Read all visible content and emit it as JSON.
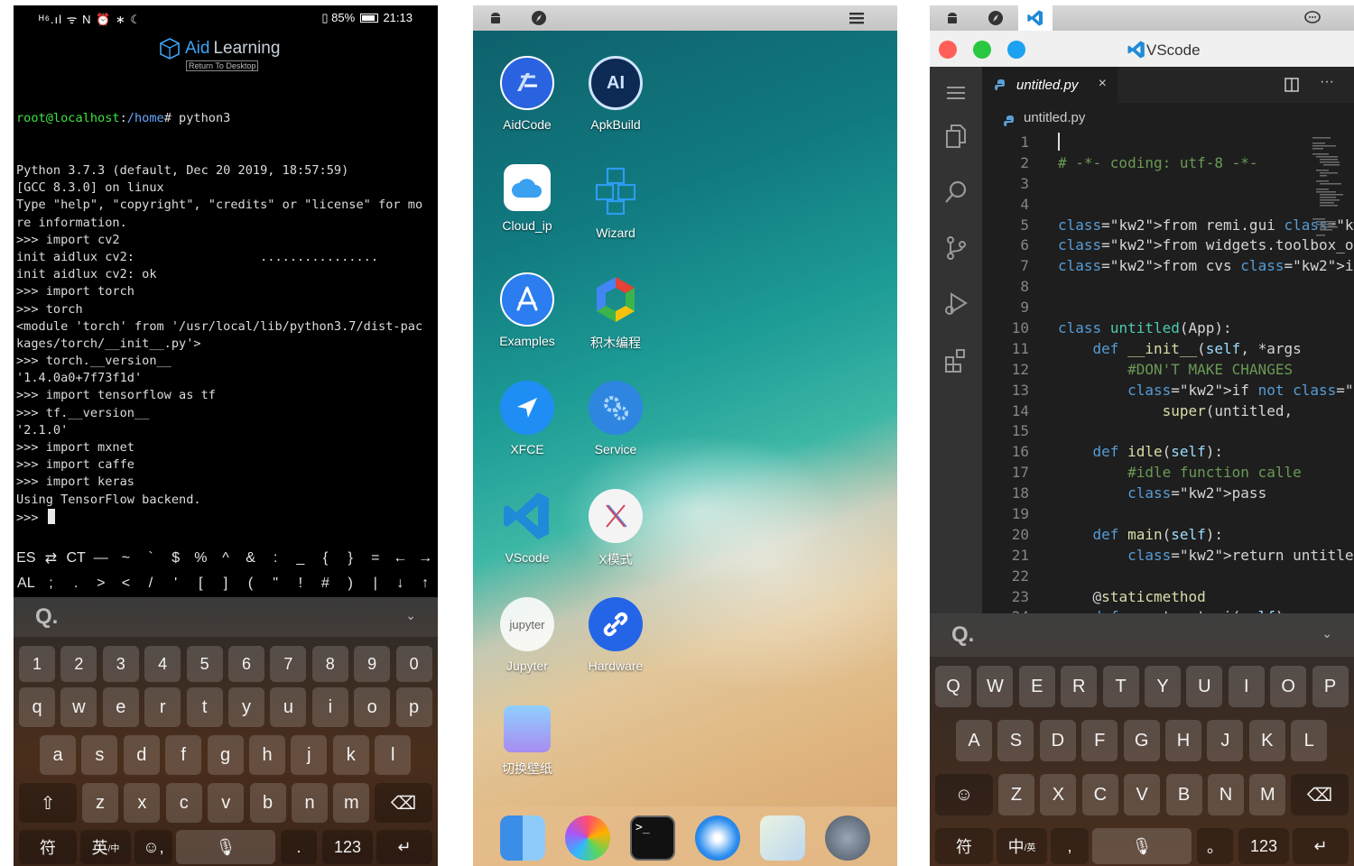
{
  "terminal_panel": {
    "status_left": "ᴴ⁶.ıl ᯤ N ⏰ ∗ ☾",
    "battery_label": "85%",
    "time": "21:13",
    "logo_text_1": "Aid",
    "logo_text_2": "Learning",
    "return_label": "Return To Desktop",
    "prompt_user": "root@localhost",
    "prompt_sep": ":",
    "prompt_path": "/home",
    "prompt_cmd": "# python3",
    "lines": [
      "Python 3.7.3 (default, Dec 20 2019, 18:57:59)",
      "[GCC 8.3.0] on linux",
      "Type \"help\", \"copyright\", \"credits\" or \"license\" for mo",
      "re information.",
      ">>> import cv2",
      "init aidlux cv2:                 ................",
      "init aidlux cv2: ok",
      ">>> import torch",
      ">>> torch",
      "<module 'torch' from '/usr/local/lib/python3.7/dist-pac",
      "kages/torch/__init__.py'>",
      ">>> torch.__version__",
      "'1.4.0a0+7f73f1d'",
      ">>> import tensorflow as tf",
      ">>> tf.__version__",
      "'2.1.0'",
      ">>> import mxnet",
      ">>> import caffe",
      ">>> import keras",
      "Using TensorFlow backend.",
      ">>> "
    ],
    "extra_keys_row1": [
      "ES",
      "⇄",
      "CT",
      "—",
      "~",
      "`",
      "$",
      "%",
      "^",
      "&",
      ":",
      "_",
      "{",
      "}",
      "=",
      "←",
      "→"
    ],
    "extra_keys_row2": [
      "AL",
      ";",
      ".",
      ">",
      "<",
      "/",
      "'",
      "[",
      "]",
      "(",
      "\"",
      "!",
      "#",
      ")",
      "|",
      "↓",
      "↑"
    ],
    "keyboard": {
      "search_glyph": "Q.",
      "collapse_glyph": "⌄",
      "number_row": [
        "1",
        "2",
        "3",
        "4",
        "5",
        "6",
        "7",
        "8",
        "9",
        "0"
      ],
      "row1": [
        "q",
        "w",
        "e",
        "r",
        "t",
        "y",
        "u",
        "i",
        "o",
        "p"
      ],
      "row2": [
        "a",
        "s",
        "d",
        "f",
        "g",
        "h",
        "j",
        "k",
        "l"
      ],
      "row3": [
        "z",
        "x",
        "c",
        "v",
        "b",
        "n",
        "m"
      ],
      "shift_glyph": "⇧",
      "backspace_glyph": "⌫",
      "symbol_key": "符",
      "lang_key": "英",
      "lang_key_sub": "/中",
      "emoji_key": "☺,",
      "mic_glyph": "🎙",
      "period_key": ".",
      "num_key": "123",
      "enter_glyph": "↵"
    }
  },
  "desktop_panel": {
    "apps": [
      {
        "label": "AidCode"
      },
      {
        "label": "ApkBuild"
      },
      {
        "label": "Cloud_ip"
      },
      {
        "label": "Wizard"
      },
      {
        "label": "Examples"
      },
      {
        "label": "积木编程"
      },
      {
        "label": "XFCE"
      },
      {
        "label": "Service"
      },
      {
        "label": "VScode"
      },
      {
        "label": "X模式"
      },
      {
        "label": "Jupyter"
      },
      {
        "label": "Hardware"
      },
      {
        "label": "切换壁纸"
      }
    ],
    "terminal_dock_glyph": ">_",
    "icon_ai_text": "AI",
    "icon_jupyter_text": "jupyter"
  },
  "vscode_panel": {
    "window_title": "VScode",
    "tab_label": "untitled.py",
    "tab_close": "×",
    "more_actions": "···",
    "breadcrumb": "untitled.py",
    "code": [
      {
        "n": "1",
        "t": ""
      },
      {
        "n": "2",
        "t": "# -*- coding: utf-8 -*-"
      },
      {
        "n": "3",
        "t": ""
      },
      {
        "n": "4",
        "t": ""
      },
      {
        "n": "5",
        "t": "from remi.gui import *"
      },
      {
        "n": "6",
        "t": "from widgets.toolbox_opencv"
      },
      {
        "n": "7",
        "t": "from cvs import *"
      },
      {
        "n": "8",
        "t": ""
      },
      {
        "n": "9",
        "t": ""
      },
      {
        "n": "10",
        "t": "class untitled(App):"
      },
      {
        "n": "11",
        "t": "    def __init__(self, *args"
      },
      {
        "n": "12",
        "t": "        #DON'T MAKE CHANGES"
      },
      {
        "n": "13",
        "t": "        if not 'editing_mode"
      },
      {
        "n": "14",
        "t": "            super(untitled,"
      },
      {
        "n": "15",
        "t": ""
      },
      {
        "n": "16",
        "t": "    def idle(self):"
      },
      {
        "n": "17",
        "t": "        #idle function calle"
      },
      {
        "n": "18",
        "t": "        pass"
      },
      {
        "n": "19",
        "t": ""
      },
      {
        "n": "20",
        "t": "    def main(self):"
      },
      {
        "n": "21",
        "t": "        return untitled.cons"
      },
      {
        "n": "22",
        "t": ""
      },
      {
        "n": "23",
        "t": "    @staticmethod"
      },
      {
        "n": "24",
        "t": "    def construct_ui(self):"
      }
    ],
    "keyboard": {
      "search_glyph": "Q.",
      "collapse_glyph": "⌄",
      "row1": [
        "Q",
        "W",
        "E",
        "R",
        "T",
        "Y",
        "U",
        "I",
        "O",
        "P"
      ],
      "row2": [
        "A",
        "S",
        "D",
        "F",
        "G",
        "H",
        "J",
        "K",
        "L"
      ],
      "row3": [
        "Z",
        "X",
        "C",
        "V",
        "B",
        "N",
        "M"
      ],
      "emoji_glyph": "☺",
      "backspace_glyph": "⌫",
      "symbol_key": "符",
      "lang_key": "中",
      "lang_key_sub": "/英",
      "comma_key": ",",
      "mic_glyph": "🎙",
      "period_key": "。",
      "num_key": "123",
      "enter_glyph": "↵"
    }
  },
  "colors": {
    "terminal_green": "#3ee23e",
    "terminal_blue": "#6aa8ff",
    "vscode_blue": "#23a9f2",
    "mac_red": "#ff5f57",
    "mac_green": "#28c840",
    "mac_blue": "#1da1f2"
  }
}
